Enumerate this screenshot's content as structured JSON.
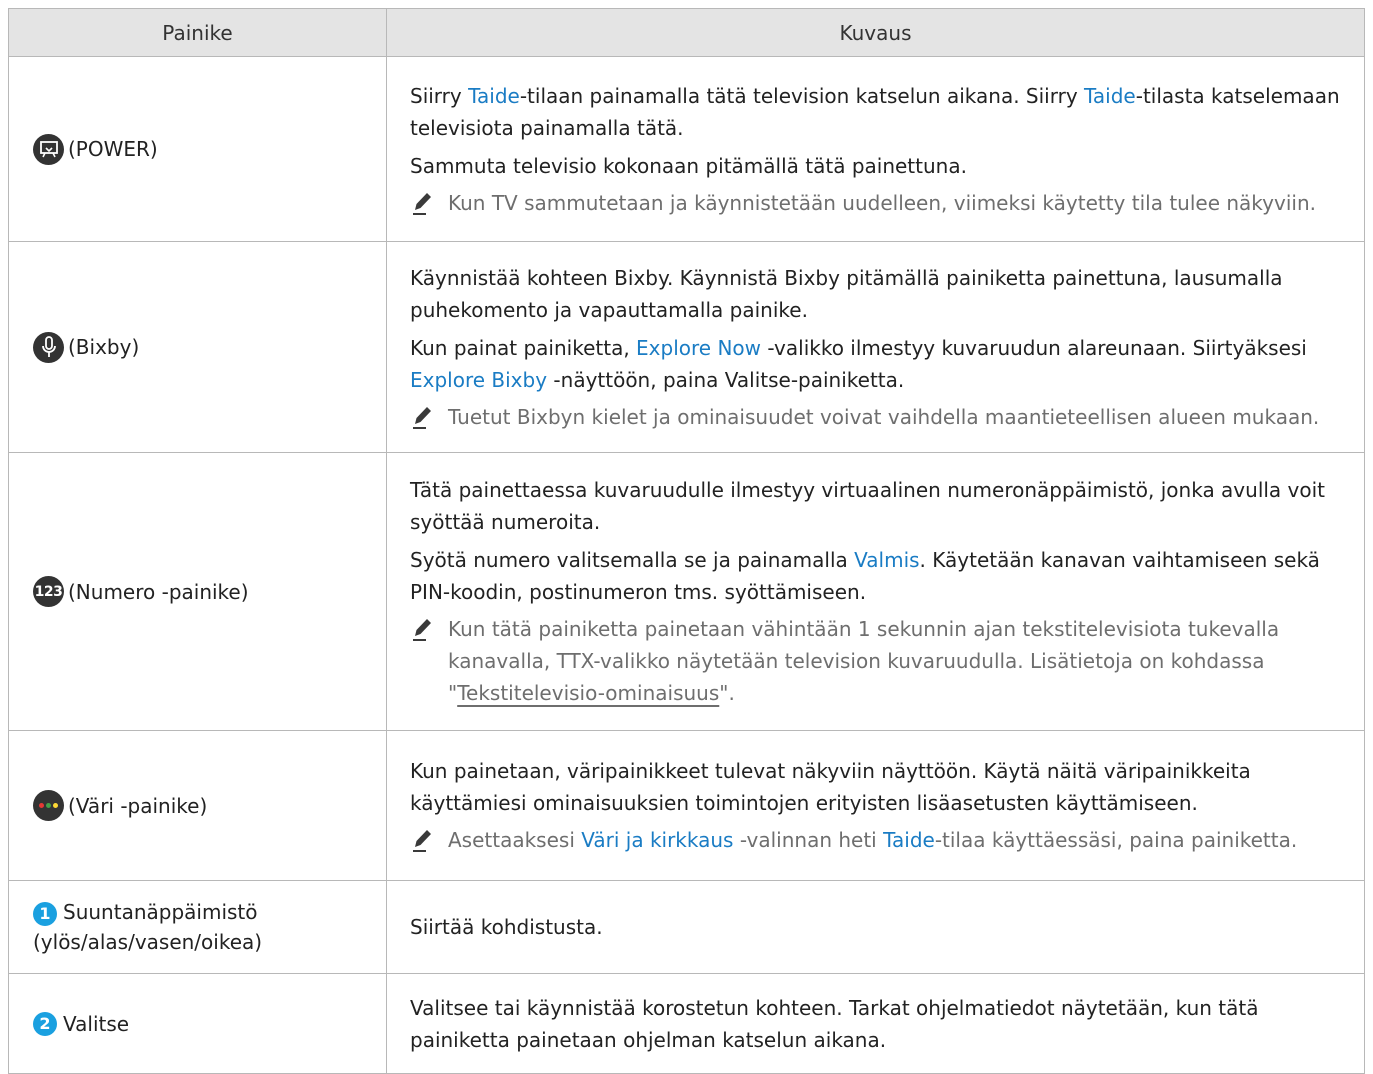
{
  "header": {
    "col_button": "Painike",
    "col_desc": "Kuvaus"
  },
  "rows": [
    {
      "icon": "art-mode-power-icon",
      "label": "(POWER)",
      "desc": [
        {
          "t1": "Siirry ",
          "h1": "Taide",
          "t2": "-tilaan painamalla tätä television katselun aikana. Siirry ",
          "h2": "Taide",
          "t3": "-tilasta katselemaan televisiota painamalla tätä."
        },
        {
          "t1": "Sammuta televisio kokonaan pitämällä tätä painettuna."
        }
      ],
      "note": "Kun TV sammutetaan ja käynnistetään uudelleen, viimeksi käytetty tila tulee näkyviin."
    },
    {
      "icon": "microphone-icon",
      "label": "(Bixby)",
      "desc": [
        {
          "t1": "Käynnistää kohteen Bixby. Käynnistä Bixby pitämällä painiketta painettuna, lausumalla puhekomento ja vapauttamalla painike."
        },
        {
          "t1": "Kun painat painiketta, ",
          "h1": "Explore Now",
          "t2": " -valikko ilmestyy kuvaruudun alareunaan. Siirtyäksesi ",
          "h2": "Explore Bixby",
          "t3": " -näyttöön, paina Valitse-painiketta."
        }
      ],
      "note": "Tuetut Bixbyn kielet ja ominaisuudet voivat vaihdella maantieteellisen alueen mukaan."
    },
    {
      "icon": "number-123-icon",
      "icon_text": "123",
      "label": "(Numero -painike)",
      "desc": [
        {
          "t1": "Tätä painettaessa kuvaruudulle ilmestyy virtuaalinen numeronäppäimistö, jonka avulla voit syöttää numeroita."
        },
        {
          "t1": "Syötä numero valitsemalla se ja painamalla ",
          "h1": "Valmis",
          "t2": ". Käytetään kanavan vaihtamiseen sekä PIN-koodin, postinumeron tms. syöttämiseen."
        }
      ],
      "note": "Kun tätä painiketta painetaan vähintään 1 sekunnin ajan tekstitelevisiota tukevalla kanavalla, TTX-valikko näytetään television kuvaruudulla. Lisätietoja on kohdassa \"",
      "note_link": "Tekstitelevisio-ominaisuus",
      "note_end": "\"."
    },
    {
      "icon": "color-dots-icon",
      "label": "(Väri -painike)",
      "dot_colors": [
        "#e53935",
        "#43a047",
        "#fdd835"
      ],
      "desc": [
        {
          "t1": "Kun painetaan, väripainikkeet tulevat näkyviin näyttöön. Käytä näitä väripainikkeita käyttämiesi ominaisuuksien toimintojen erityisten lisäasetusten käyttämiseen."
        }
      ],
      "note_parts": {
        "t1": "Asettaaksesi ",
        "h1": "Väri ja kirkkaus",
        "t2": " -valinnan heti ",
        "h2": "Taide",
        "t3": "-tilaa käyttäessäsi, paina painiketta."
      }
    },
    {
      "icon": "number-1-icon",
      "icon_text": "1",
      "label": "Suuntanäppäimistö",
      "label2": "(ylös/alas/vasen/oikea)",
      "desc": [
        {
          "t1": "Siirtää kohdistusta."
        }
      ]
    },
    {
      "icon": "number-2-icon",
      "icon_text": "2",
      "label": "Valitse",
      "desc": [
        {
          "t1": "Valitsee tai käynnistää korostetun kohteen. Tarkat ohjelmatiedot näytetään, kun tätä painiketta painetaan ohjelman katselun aikana."
        }
      ]
    }
  ],
  "colors": {
    "accent": "#1a7cc4",
    "note_text": "#6e6e6e",
    "header_bg": "#e4e4e4",
    "icon_bg": "#333333",
    "dir_icon_bg": "#1aa0e0"
  }
}
